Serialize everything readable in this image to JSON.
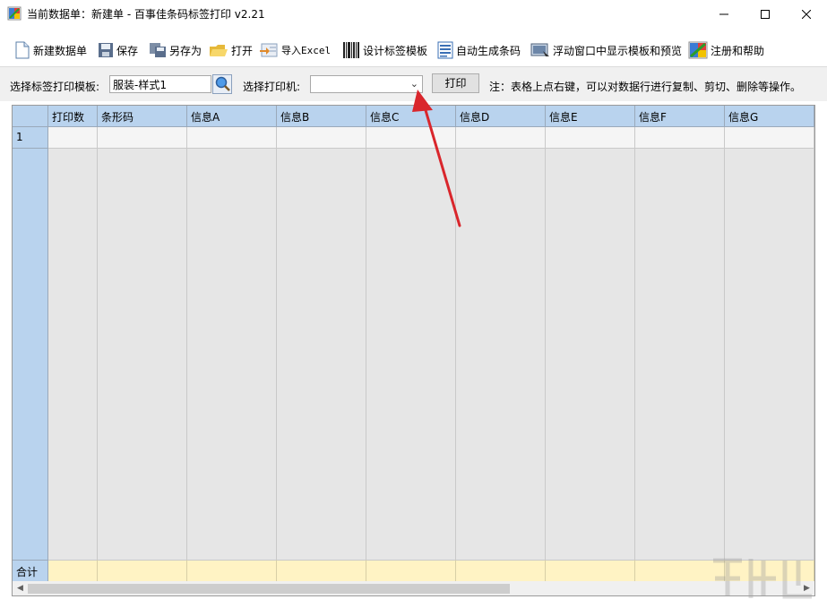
{
  "window": {
    "title": "当前数据单：新建单 - 百事佳条码标签打印 v2.21"
  },
  "toolbar": {
    "items": [
      {
        "label": "新建数据单",
        "icon": "new-document-icon"
      },
      {
        "label": "保存",
        "icon": "save-disk-icon"
      },
      {
        "label": "另存为",
        "icon": "save-as-icon"
      },
      {
        "label": "打开",
        "icon": "open-folder-icon"
      },
      {
        "label": "导入Excel",
        "icon": "import-excel-icon"
      },
      {
        "label": "设计标签模板",
        "icon": "barcode-icon"
      },
      {
        "label": "自动生成条码",
        "icon": "list-icon"
      },
      {
        "label": "浮动窗口中显示模板和预览",
        "icon": "preview-window-icon"
      },
      {
        "label": "注册和帮助",
        "icon": "help-icon"
      }
    ]
  },
  "controls": {
    "template_label": "选择标签打印模板:",
    "template_value": "服装-样式1",
    "printer_label": "选择打印机:",
    "printer_value": "",
    "print_button": "打印",
    "note": "注：表格上点右键，可以对数据行进行复制、剪切、删除等操作。"
  },
  "grid": {
    "columns": [
      "打印数",
      "条形码",
      "信息A",
      "信息B",
      "信息C",
      "信息D",
      "信息E",
      "信息F",
      "信息G"
    ],
    "rows": [
      {
        "row_number": "1",
        "cells": [
          "",
          "",
          "",
          "",
          "",
          "",
          "",
          "",
          ""
        ]
      }
    ],
    "total_label": "合计"
  },
  "colors": {
    "header_bg": "#b9d3ee",
    "total_row_bg": "#fff3c4",
    "annotation_arrow": "#d9262c"
  }
}
